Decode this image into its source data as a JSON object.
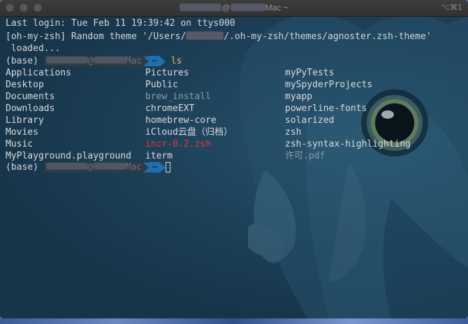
{
  "window": {
    "title_suffix": "Mac ~",
    "title_at": "@",
    "shortcut": "⌥⌘1"
  },
  "terminal": {
    "last_login": "Last login: Tue Feb 11 19:39:42 on ttys000",
    "theme_line_prefix": "[oh-my-zsh] Random theme '/Users/",
    "theme_line_suffix": "/.oh-my-zsh/themes/agnoster.zsh-theme'",
    "theme_line_loaded": " loaded...",
    "prompt1": {
      "env": "(base) ",
      "at": "@",
      "host_suffix": "Mac",
      "dir": "~",
      "command": "ls"
    },
    "ls_columns": [
      [
        {
          "name": "Applications",
          "kind": "dir"
        },
        {
          "name": "Desktop",
          "kind": "dir"
        },
        {
          "name": "Documents",
          "kind": "dir"
        },
        {
          "name": "Downloads",
          "kind": "dir"
        },
        {
          "name": "Library",
          "kind": "dir"
        },
        {
          "name": "Movies",
          "kind": "dir"
        },
        {
          "name": "Music",
          "kind": "dir"
        },
        {
          "name": "MyPlayground.playground",
          "kind": "dir"
        }
      ],
      [
        {
          "name": "Pictures",
          "kind": "dir"
        },
        {
          "name": "Public",
          "kind": "dir"
        },
        {
          "name": "brew_install",
          "kind": "file"
        },
        {
          "name": "chromeEXT",
          "kind": "dir"
        },
        {
          "name": "homebrew-core",
          "kind": "dir"
        },
        {
          "name": "iCloud云盘（归档）",
          "kind": "dir"
        },
        {
          "name": "incr-0.2.zsh",
          "kind": "exec"
        },
        {
          "name": "iterm",
          "kind": "dir"
        }
      ],
      [
        {
          "name": "myPyTests",
          "kind": "dir"
        },
        {
          "name": "mySpyderProjects",
          "kind": "dir"
        },
        {
          "name": "myapp",
          "kind": "dir"
        },
        {
          "name": "powerline-fonts",
          "kind": "dir"
        },
        {
          "name": "solarized",
          "kind": "dir"
        },
        {
          "name": "zsh",
          "kind": "dir"
        },
        {
          "name": "zsh-syntax-highlighting",
          "kind": "dir"
        },
        {
          "name": "许可.pdf",
          "kind": "file"
        }
      ]
    ],
    "prompt2": {
      "env": "(base) ",
      "at": "@",
      "host_suffix": "Mac",
      "dir": "~"
    },
    "colors": {
      "background": "#173449",
      "text": "#d3d6d8",
      "directory": "#d9dbdd",
      "plain_file": "#8d9aa3",
      "executable": "#e0383b",
      "command": "#d9c84a",
      "prompt_path_bg": "#1f6fb0",
      "prompt_user_bg": "#2f3a44"
    }
  }
}
